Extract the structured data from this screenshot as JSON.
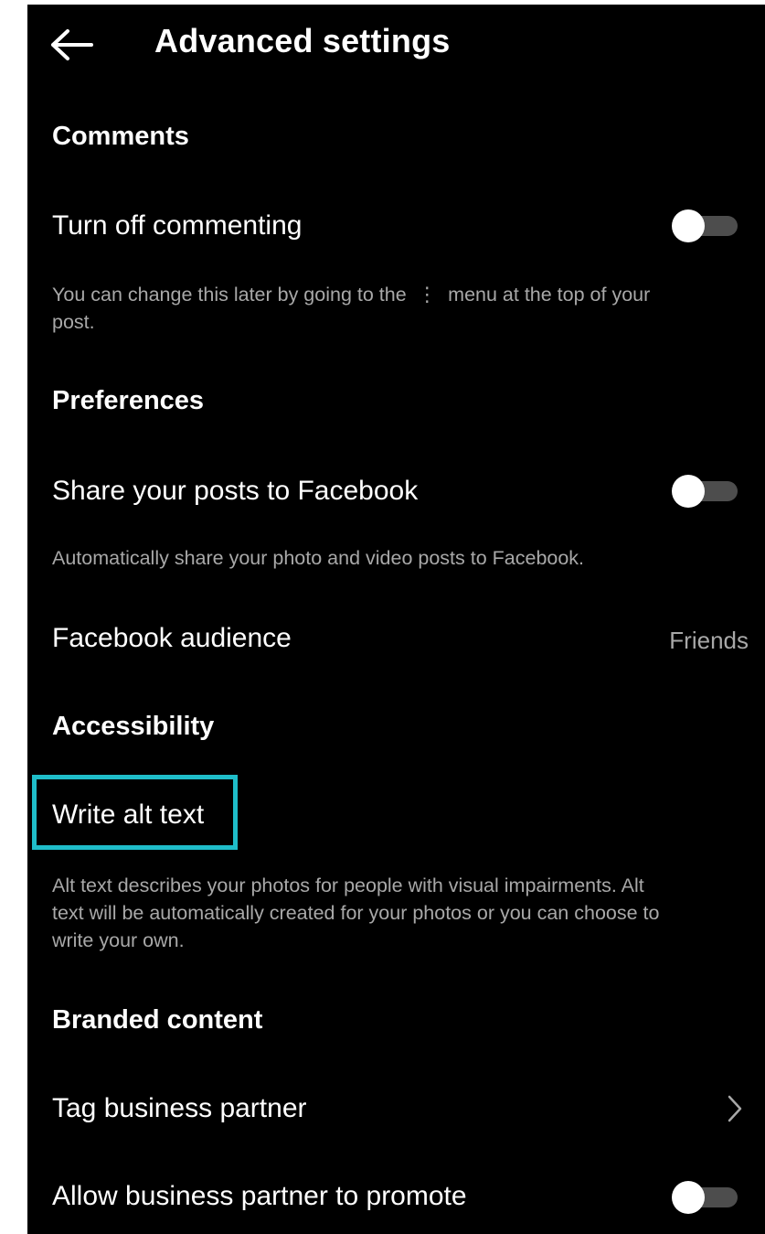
{
  "header": {
    "title": "Advanced settings",
    "back_icon": "arrow-left-icon"
  },
  "comments": {
    "section_title": "Comments",
    "turn_off_commenting": {
      "label": "Turn off commenting",
      "enabled": false
    },
    "description_part1": "You can change this later by going to the",
    "menu_glyph": "⋮",
    "description_part2": "menu at the top of your",
    "description_line2": "post."
  },
  "preferences": {
    "section_title": "Preferences",
    "share_to_facebook": {
      "label": "Share your posts to Facebook",
      "enabled": false
    },
    "share_description": "Automatically share your photo and video posts to Facebook.",
    "facebook_audience": {
      "label": "Facebook audience",
      "value": "Friends"
    }
  },
  "accessibility": {
    "section_title": "Accessibility",
    "write_alt_text": {
      "label": "Write alt text"
    },
    "description_lines": [
      "Alt text describes your photos for people with visual impairments. Alt",
      "text will be automatically created for your photos or you can choose to",
      "write your own."
    ],
    "highlight_color": "#1fbdc9"
  },
  "branded_content": {
    "section_title": "Branded content",
    "tag_business_partner": {
      "label": "Tag business partner",
      "icon": "chevron-right-icon"
    },
    "allow_partner_promote": {
      "label": "Allow business partner to promote",
      "enabled": false
    }
  },
  "colors": {
    "background": "#000000",
    "text_primary": "#ffffff",
    "text_secondary": "#a8a8a8",
    "toggle_track_off": "#4d4d4d",
    "toggle_knob": "#ffffff"
  }
}
